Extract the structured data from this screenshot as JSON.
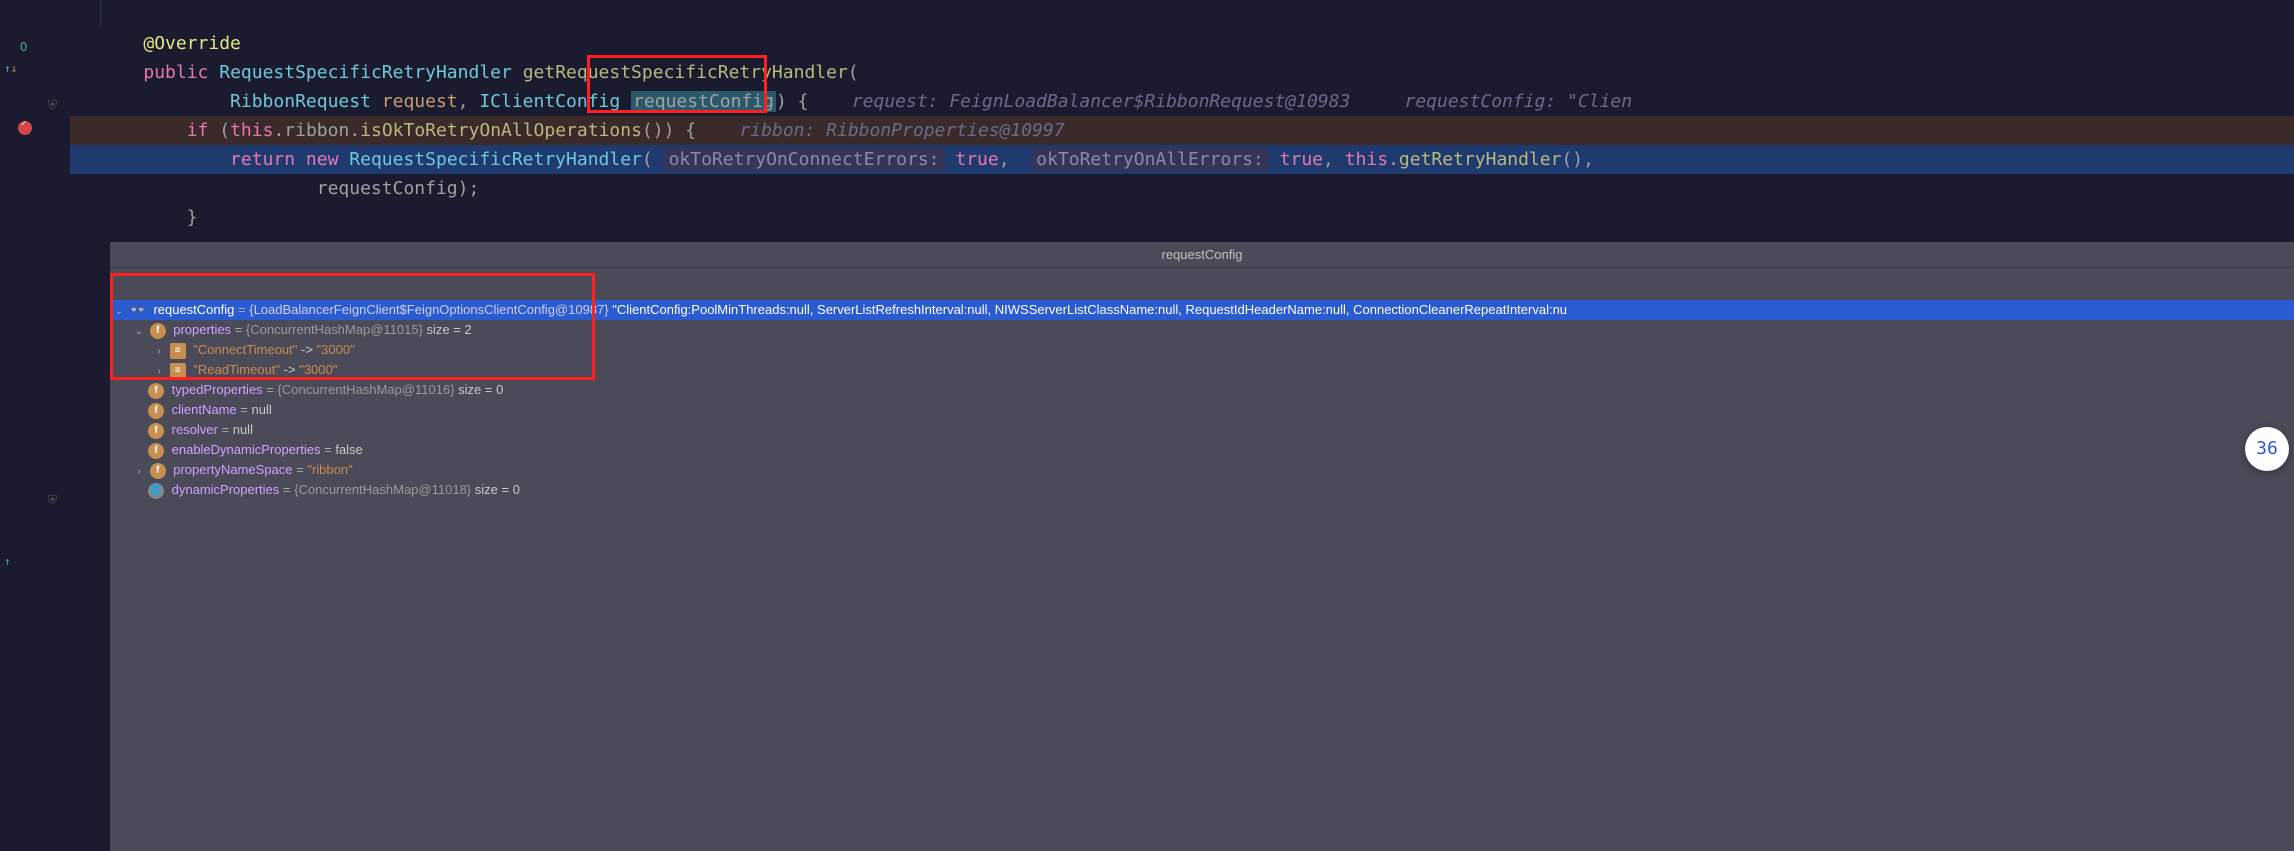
{
  "code": {
    "override": "@Override",
    "public": "public",
    "retType": "RequestSpecificRetryHandler",
    "methodName": "getRequestSpecificRetryHandler",
    "paramType1": "RibbonRequest",
    "paramName1": "request",
    "paramType2": "IClientConfig",
    "paramName2": "requestConfig",
    "inlineParam1": "request: FeignLoadBalancer$RibbonRequest@10983",
    "inlineParam2": "requestConfig: \"Clien",
    "if": "if",
    "thisKw": "this",
    "ribbonField": "ribbon",
    "isOkMethod": "isOkToRetryOnAllOperations",
    "inlineRibbon": "ribbon: RibbonProperties@10997",
    "return": "return",
    "new": "new",
    "ctor": "RequestSpecificRetryHandler",
    "hint1": "okToRetryOnConnectErrors:",
    "true1": "true",
    "hint2": "okToRetryOnAllErrors:",
    "true2": "true",
    "getRetry": "getRetryHandler",
    "reqCfgTail": "requestConfig);"
  },
  "debug": {
    "header": "requestConfig",
    "root": {
      "name": "requestConfig",
      "cls": "{LoadBalancerFeignClient$FeignOptionsClientConfig@10987}",
      "val": "\"ClientConfig:PoolMinThreads:null, ServerListRefreshInterval:null, NIWSServerListClassName:null, RequestIdHeaderName:null, ConnectionCleanerRepeatInterval:nu"
    },
    "properties": {
      "name": "properties",
      "cls": "{ConcurrentHashMap@11015}",
      "size": " size = 2"
    },
    "connTimeout": {
      "key": "\"ConnectTimeout\"",
      "arrow": " -> ",
      "val": "\"3000\""
    },
    "readTimeout": {
      "key": "\"ReadTimeout\"",
      "arrow": " -> ",
      "val": "\"3000\""
    },
    "typedProperties": {
      "name": "typedProperties",
      "cls": "{ConcurrentHashMap@11016}",
      "size": " size = 0"
    },
    "clientName": {
      "name": "clientName",
      "val": "null"
    },
    "resolver": {
      "name": "resolver",
      "val": "null"
    },
    "enableDyn": {
      "name": "enableDynamicProperties",
      "val": "false"
    },
    "propNs": {
      "name": "propertyNameSpace",
      "val": "\"ribbon\""
    },
    "dynProps": {
      "name": "dynamicProperties",
      "cls": "{ConcurrentHashMap@11018}",
      "size": " size = 0"
    }
  },
  "badge": "36",
  "gutter": {
    "up": "↑",
    "down": "↓"
  }
}
